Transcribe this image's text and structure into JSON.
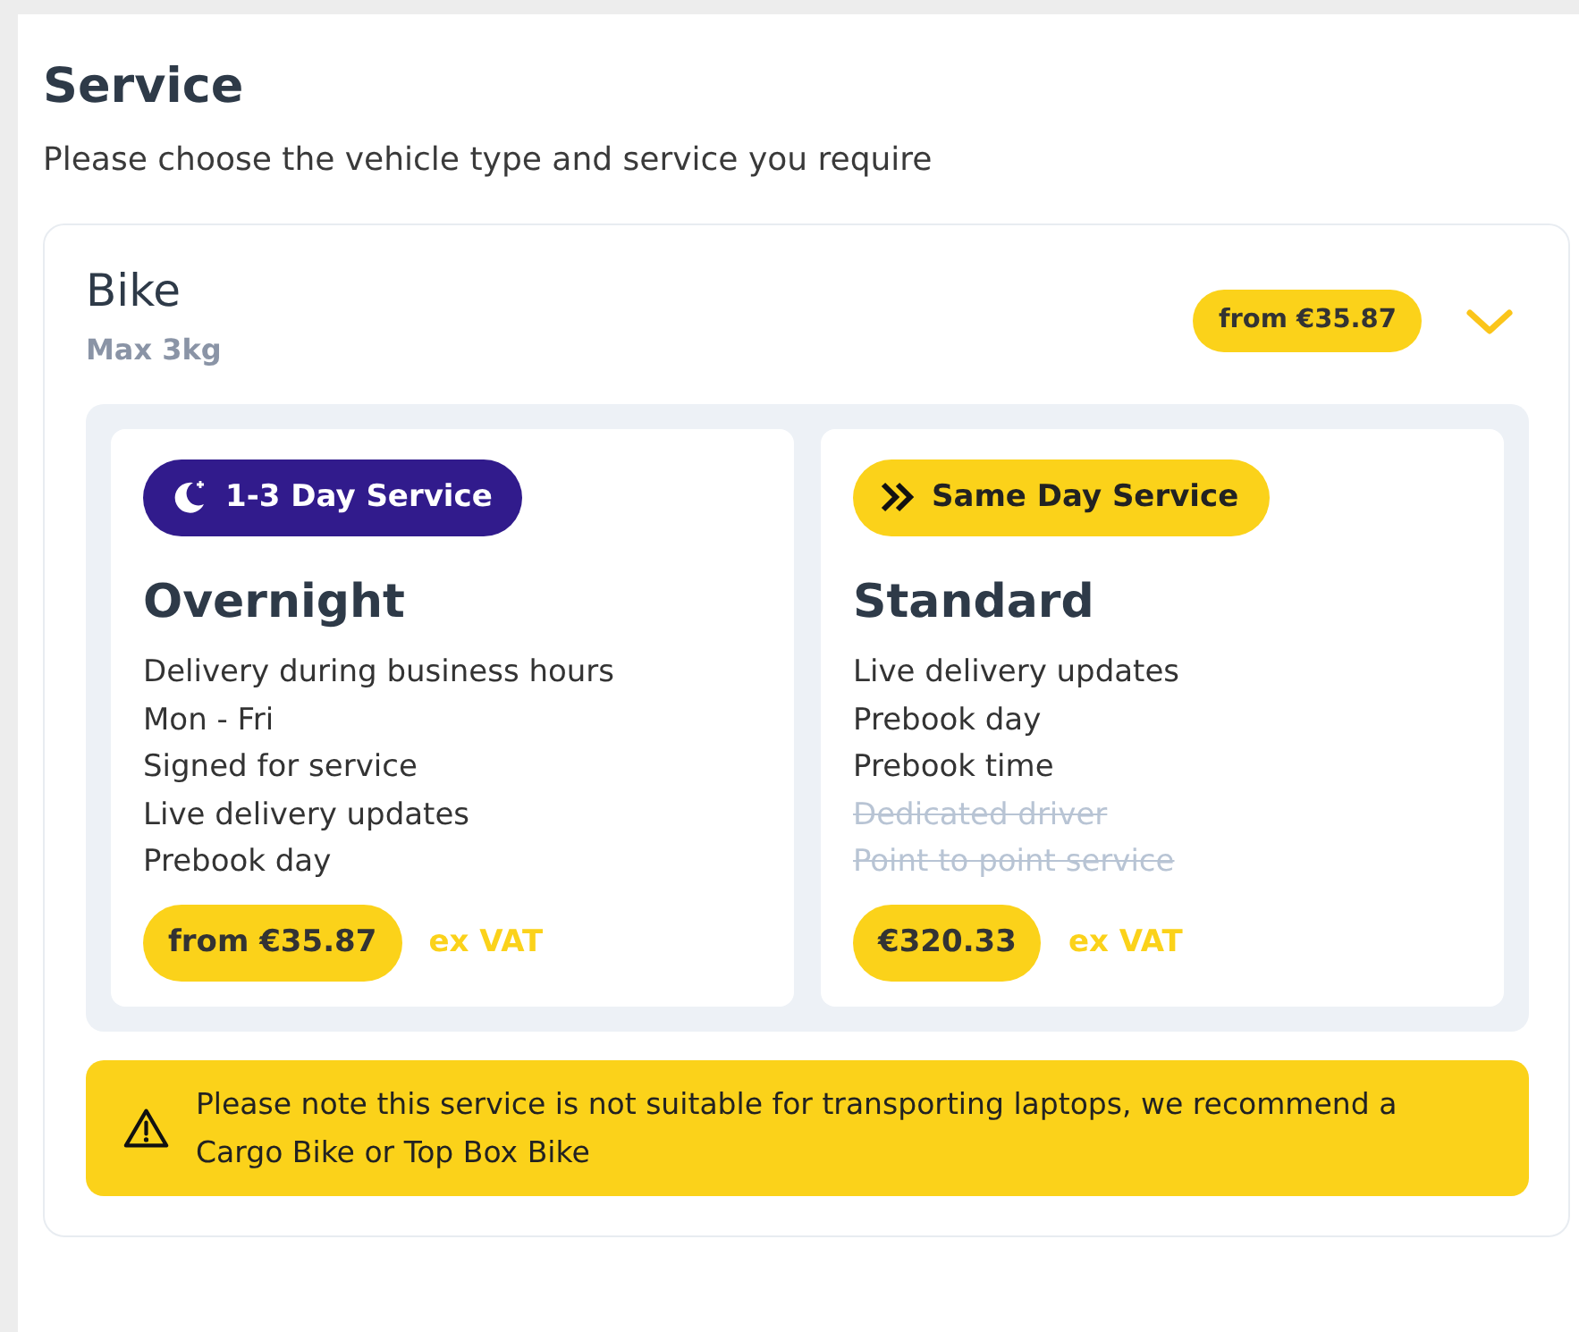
{
  "header": {
    "title": "Service",
    "subtitle": "Please choose the vehicle type and service you require"
  },
  "vehicle": {
    "name": "Bike",
    "capacity": "Max 3kg",
    "price": "from €35.87",
    "expanded": true,
    "services": [
      {
        "badge": {
          "kind": "overnight",
          "label": "1-3 Day Service"
        },
        "name": "Overnight",
        "features": [
          {
            "text": "Delivery during business hours",
            "available": true
          },
          {
            "text": "Mon - Fri",
            "available": true
          },
          {
            "text": "Signed for service",
            "available": true
          },
          {
            "text": "Live delivery updates",
            "available": true
          },
          {
            "text": "Prebook day",
            "available": true
          }
        ],
        "price": "from €35.87",
        "tax_note": "ex VAT"
      },
      {
        "badge": {
          "kind": "same-day",
          "label": "Same Day Service"
        },
        "name": "Standard",
        "features": [
          {
            "text": "Live delivery updates",
            "available": true
          },
          {
            "text": "Prebook day",
            "available": true
          },
          {
            "text": "Prebook time",
            "available": true
          },
          {
            "text": "Dedicated driver",
            "available": false
          },
          {
            "text": "Point to point service",
            "available": false
          }
        ],
        "price": "€320.33",
        "tax_note": "ex VAT"
      }
    ],
    "notice": "Please note this service is not suitable for transporting laptops, we recommend a Cargo Bike or Top Box Bike"
  }
}
